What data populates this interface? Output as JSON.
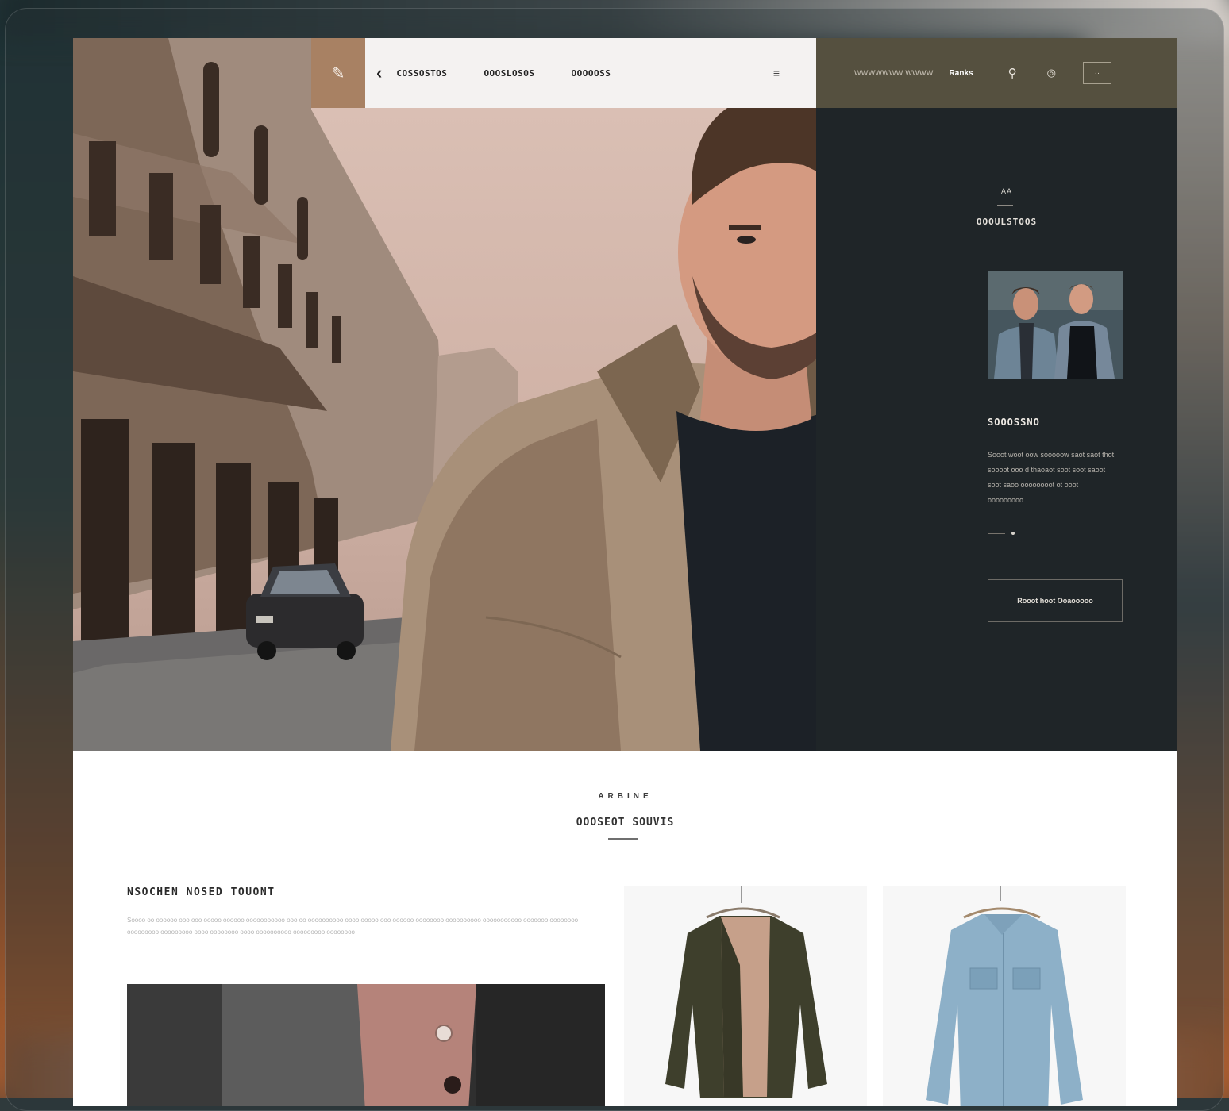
{
  "nav": {
    "logo_glyph": "✎",
    "back_glyph": "‹",
    "links": [
      "COSSOSTOS",
      "OOOSLOSOS",
      "OOOOOSS"
    ],
    "menu_glyph": "≡",
    "promo_text": "WWWWWWW WWWW",
    "account_label": "Ranks",
    "search_glyph": "⚲",
    "account_glyph": "◎",
    "cart_label": "··"
  },
  "side_panel": {
    "kicker": "AA",
    "title": "OOOULSTOOS",
    "heading": "SOOOSSNO",
    "body": "Sooot woot oow sooooow saot saot thot soooot ooo d thaoaot soot soot saoot soot saoo oooooooot ot ooot ooooooooo",
    "cta_label": "Rooot hoot Ooaooooo"
  },
  "section": {
    "kicker": "ARBINE",
    "title": "OOOSEOT SOUVIS"
  },
  "feature": {
    "title": "NSOCHEN NOSED TOUONT",
    "body": "Soooo oo oooooo ooo ooo ooooo oooooo ooooooooooo ooo oo oooooooooo oooo ooooo ooo oooooo oooooooo oooooooooo ooooooooooo ooooooo oooooooo ooooooooo ooooooooo oooo oooooooo oooo oooooooooo ooooooooo oooooooo"
  },
  "colors": {
    "nav_logo_bg": "#a88163",
    "nav_dark_bg": "#55503f",
    "side_panel_bg": "#1f2528",
    "hero_sky": "#d0b2a6"
  }
}
